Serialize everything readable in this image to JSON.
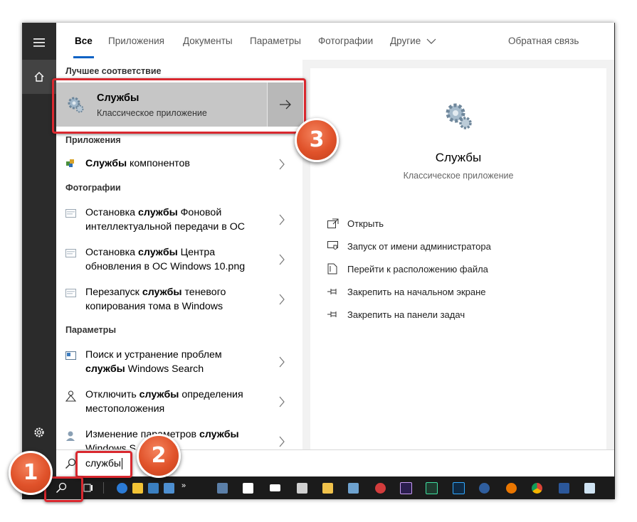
{
  "tabs": [
    {
      "label": "Все"
    },
    {
      "label": "Приложения"
    },
    {
      "label": "Документы"
    },
    {
      "label": "Параметры"
    },
    {
      "label": "Фотографии"
    },
    {
      "label": "Другие"
    }
  ],
  "feedback_label": "Обратная связь",
  "more_label": "...",
  "best_match": {
    "section": "Лучшее соответствие",
    "title": "Службы",
    "subtitle": "Классическое приложение"
  },
  "sections": {
    "apps": "Приложения",
    "photos": "Фотографии",
    "settings": "Параметры"
  },
  "apps": [
    {
      "bold": "Службы",
      "rest": " компонентов"
    }
  ],
  "photos": [
    {
      "line1_pre": "Остановка ",
      "line1_bold": "службы",
      "line1_post": " Фоновой",
      "line2": "интеллектуальной передачи в ОС"
    },
    {
      "line1_pre": "Остановка ",
      "line1_bold": "службы",
      "line1_post": " Центра",
      "line2": "обновления в ОС Windows 10.png"
    },
    {
      "line1_pre": "Перезапуск ",
      "line1_bold": "службы",
      "line1_post": " теневого",
      "line2": "копирования тома в Windows"
    }
  ],
  "settings": [
    {
      "line1": "Поиск и устранение проблем",
      "line2_bold": "службы",
      "line2_post": " Windows Search"
    },
    {
      "line1_pre": "Отключить ",
      "line1_bold": "службы",
      "line1_post": " определения",
      "line2": "местоположения"
    },
    {
      "line1_pre": "Изменение параметров ",
      "line1_bold": "службы",
      "line2": "Windows S"
    }
  ],
  "detail": {
    "title": "Службы",
    "subtitle": "Классическое приложение",
    "actions": [
      {
        "label": "Открыть",
        "icon": "open-icon"
      },
      {
        "label": "Запуск от имени администратора",
        "icon": "shield-admin-icon"
      },
      {
        "label": "Перейти к расположению файла",
        "icon": "file-location-icon"
      },
      {
        "label": "Закрепить на начальном экране",
        "icon": "pin-icon"
      },
      {
        "label": "Закрепить на панели задач",
        "icon": "pin-icon"
      }
    ]
  },
  "search": {
    "value": "службы"
  },
  "badges": {
    "one": "1",
    "two": "2",
    "three": "3"
  },
  "colors": {
    "accent": "#0b62c4",
    "highlight": "#d9282f",
    "badge": "#e0522a"
  },
  "taskbar_icons": [
    "search-icon",
    "task-view-icon",
    "edge-icon",
    "notes-icon",
    "box-icon",
    "id-card-icon",
    "overflow-icon",
    "rdp-icon",
    "store-icon",
    "mail-icon",
    "calculator-icon",
    "explorer-icon",
    "photos-icon",
    "record-icon",
    "after-effects-icon",
    "audition-icon",
    "photoshop-icon",
    "cinema4d-icon",
    "blender-icon",
    "chrome-icon",
    "word-icon",
    "notepad-icon"
  ]
}
